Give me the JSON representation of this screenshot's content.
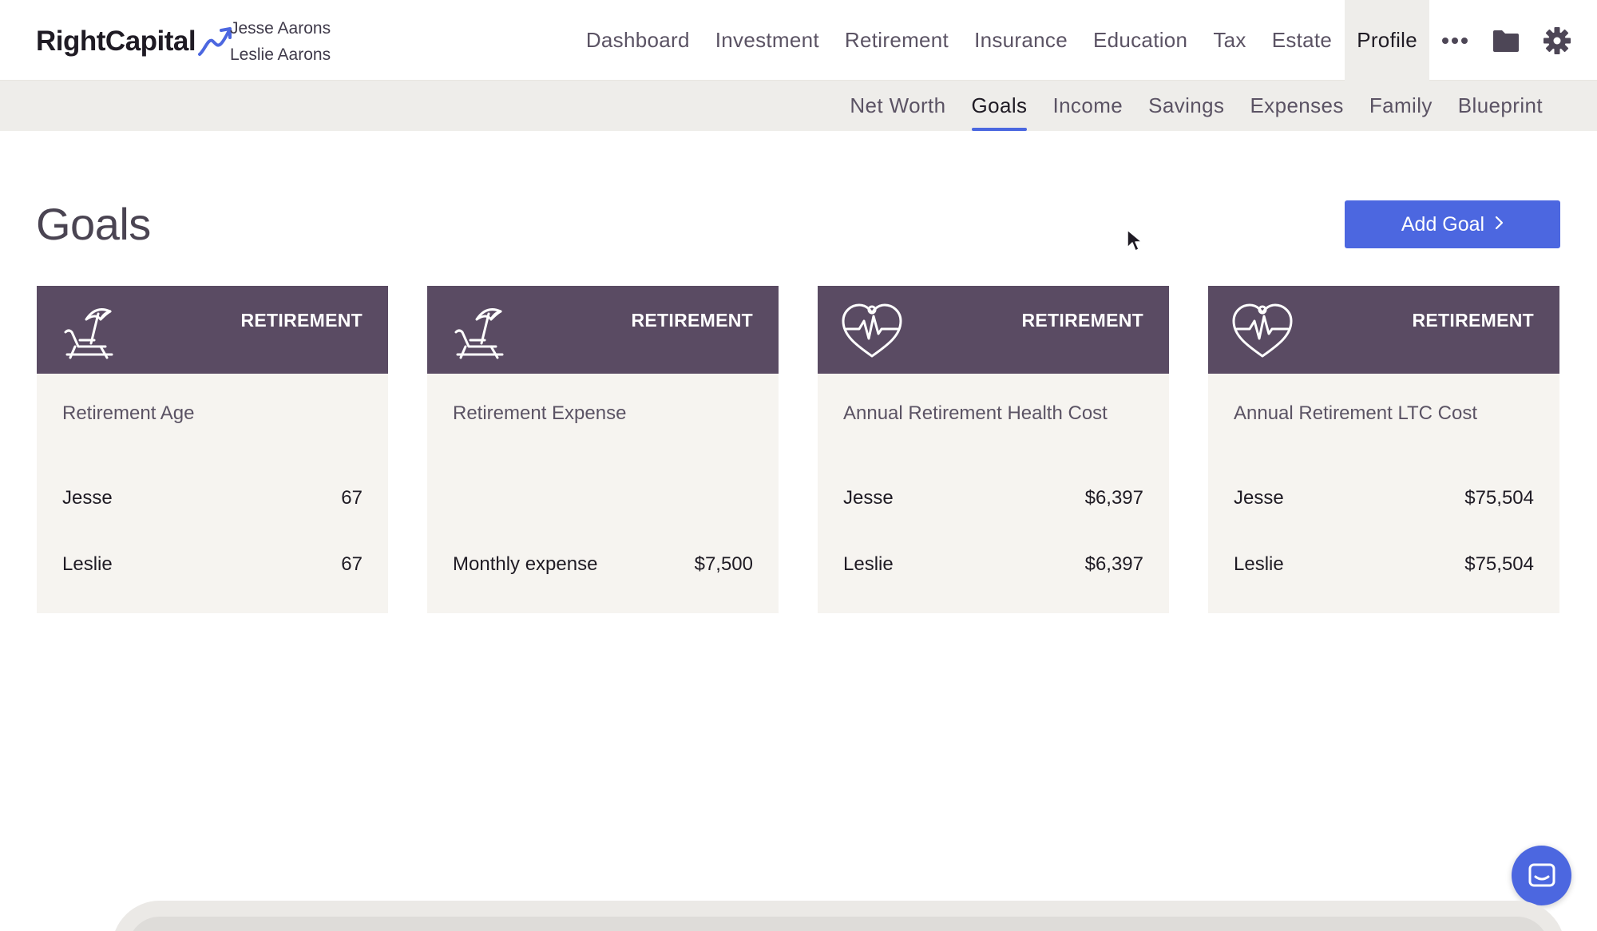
{
  "brand": {
    "name": "RightCapital"
  },
  "clients": {
    "primary": "Jesse Aarons",
    "secondary": "Leslie Aarons"
  },
  "main_nav": {
    "items": [
      "Dashboard",
      "Investment",
      "Retirement",
      "Insurance",
      "Education",
      "Tax",
      "Estate",
      "Profile"
    ],
    "active": "Profile",
    "icons": [
      "more-icon",
      "folder-icon",
      "gear-icon"
    ]
  },
  "sub_nav": {
    "items": [
      "Net Worth",
      "Goals",
      "Income",
      "Savings",
      "Expenses",
      "Family",
      "Blueprint"
    ],
    "active": "Goals"
  },
  "page": {
    "title": "Goals",
    "add_button": "Add Goal"
  },
  "cards": [
    {
      "category": "RETIREMENT",
      "icon": "beach-chair-icon",
      "title": "Retirement Age",
      "rows": [
        {
          "label": "Jesse",
          "value": "67"
        },
        {
          "label": "Leslie",
          "value": "67"
        }
      ]
    },
    {
      "category": "RETIREMENT",
      "icon": "beach-chair-icon",
      "title": "Retirement Expense",
      "rows": [
        {
          "label": "",
          "value": ""
        },
        {
          "label": "Monthly expense",
          "value": "$7,500"
        }
      ]
    },
    {
      "category": "RETIREMENT",
      "icon": "heart-pulse-icon",
      "title": "Annual Retirement Health Cost",
      "rows": [
        {
          "label": "Jesse",
          "value": "$6,397"
        },
        {
          "label": "Leslie",
          "value": "$6,397"
        }
      ]
    },
    {
      "category": "RETIREMENT",
      "icon": "heart-pulse-icon",
      "title": "Annual Retirement LTC Cost",
      "rows": [
        {
          "label": "Jesse",
          "value": "$75,504"
        },
        {
          "label": "Leslie",
          "value": "$75,504"
        }
      ]
    }
  ],
  "colors": {
    "accent": "#4c67e0",
    "card_header": "#5a4b63",
    "card_body": "#f6f4f0",
    "subnav_bg": "#eeedea"
  }
}
